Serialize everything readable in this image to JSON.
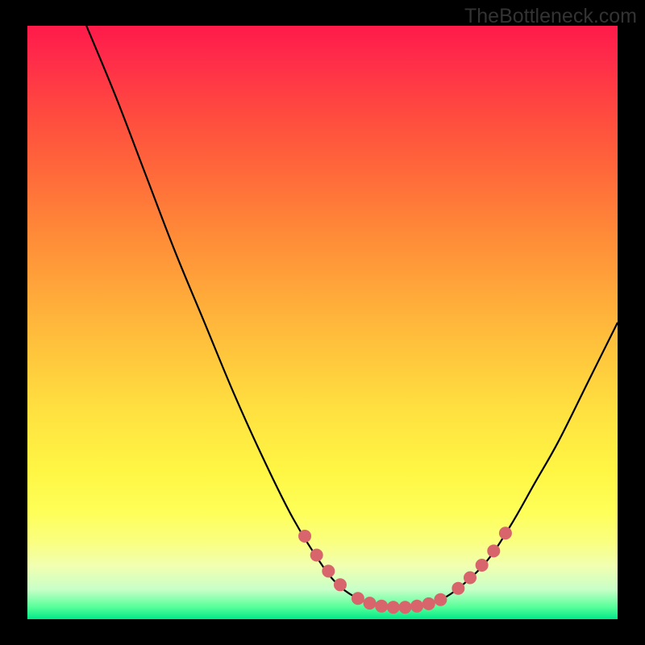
{
  "watermark": "TheBottleneck.com",
  "chart_data": {
    "type": "line",
    "title": "",
    "xlabel": "",
    "ylabel": "",
    "xlim": [
      0,
      100
    ],
    "ylim": [
      0,
      100
    ],
    "curve": {
      "name": "bottleneck-curve",
      "points": [
        {
          "x": 10.0,
          "y": 100.0
        },
        {
          "x": 15.0,
          "y": 88.0
        },
        {
          "x": 20.0,
          "y": 75.0
        },
        {
          "x": 25.0,
          "y": 62.0
        },
        {
          "x": 30.0,
          "y": 50.0
        },
        {
          "x": 35.0,
          "y": 38.0
        },
        {
          "x": 40.0,
          "y": 27.0
        },
        {
          "x": 45.0,
          "y": 17.0
        },
        {
          "x": 50.0,
          "y": 9.0
        },
        {
          "x": 53.0,
          "y": 5.5
        },
        {
          "x": 56.0,
          "y": 3.5
        },
        {
          "x": 59.0,
          "y": 2.4
        },
        {
          "x": 62.0,
          "y": 2.0
        },
        {
          "x": 65.0,
          "y": 2.0
        },
        {
          "x": 68.0,
          "y": 2.5
        },
        {
          "x": 71.0,
          "y": 3.8
        },
        {
          "x": 74.0,
          "y": 6.0
        },
        {
          "x": 78.0,
          "y": 10.0
        },
        {
          "x": 82.0,
          "y": 16.0
        },
        {
          "x": 86.0,
          "y": 23.0
        },
        {
          "x": 90.0,
          "y": 30.0
        },
        {
          "x": 95.0,
          "y": 40.0
        },
        {
          "x": 100.0,
          "y": 50.0
        }
      ]
    },
    "markers": {
      "name": "highlight-dots",
      "color": "#d8656c",
      "points": [
        {
          "x": 47.0,
          "y": 14.0
        },
        {
          "x": 49.0,
          "y": 10.8
        },
        {
          "x": 51.0,
          "y": 8.1
        },
        {
          "x": 53.0,
          "y": 5.8
        },
        {
          "x": 56.0,
          "y": 3.5
        },
        {
          "x": 58.0,
          "y": 2.7
        },
        {
          "x": 60.0,
          "y": 2.2
        },
        {
          "x": 62.0,
          "y": 2.0
        },
        {
          "x": 64.0,
          "y": 2.0
        },
        {
          "x": 66.0,
          "y": 2.2
        },
        {
          "x": 68.0,
          "y": 2.6
        },
        {
          "x": 70.0,
          "y": 3.3
        },
        {
          "x": 73.0,
          "y": 5.2
        },
        {
          "x": 75.0,
          "y": 7.0
        },
        {
          "x": 77.0,
          "y": 9.1
        },
        {
          "x": 79.0,
          "y": 11.5
        },
        {
          "x": 81.0,
          "y": 14.5
        }
      ]
    }
  }
}
